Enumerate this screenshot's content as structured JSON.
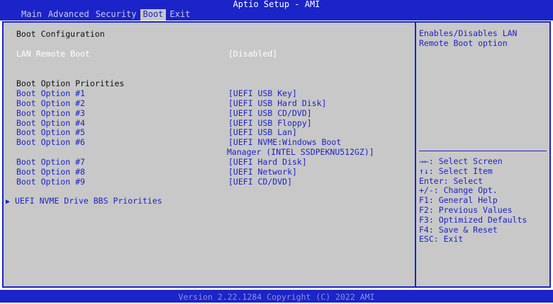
{
  "app": {
    "title": "Aptio Setup - AMI"
  },
  "tabs": [
    {
      "label": "Main"
    },
    {
      "label": "Advanced"
    },
    {
      "label": "Security"
    },
    {
      "label": "Boot",
      "active": true
    },
    {
      "label": "Exit"
    }
  ],
  "main": {
    "section_title": "Boot Configuration",
    "lan_remote_boot": {
      "label": "LAN Remote Boot",
      "value": "[Disabled]"
    },
    "priorities_title": "Boot Option Priorities",
    "boot_options": [
      {
        "label": "Boot Option #1",
        "value": "[UEFI USB Key]"
      },
      {
        "label": "Boot Option #2",
        "value": "[UEFI USB Hard Disk]"
      },
      {
        "label": "Boot Option #3",
        "value": "[UEFI USB CD/DVD]"
      },
      {
        "label": "Boot Option #4",
        "value": "[UEFI USB Floppy]"
      },
      {
        "label": "Boot Option #5",
        "value": "[UEFI USB Lan]"
      },
      {
        "label": "Boot Option #6",
        "value": "[UEFI NVME:Windows Boot",
        "value_cont": "Manager (INTEL SSDPEKNU512GZ)]"
      },
      {
        "label": "Boot Option #7",
        "value": "[UEFI Hard Disk]"
      },
      {
        "label": "Boot Option #8",
        "value": "[UEFI Network]"
      },
      {
        "label": "Boot Option #9",
        "value": "[UEFI CD/DVD]"
      }
    ],
    "submenu": {
      "label": "UEFI NVME Drive BBS Priorities",
      "arrow": "▶"
    }
  },
  "help": {
    "text": "Enables/Disables LAN\nRemote Boot option",
    "keys": [
      "→←: Select Screen",
      "↑↓: Select Item",
      "Enter: Select",
      "+/-: Change Opt.",
      "F1: General Help",
      "F2: Previous Values",
      "F3: Optimized Defaults",
      "F4: Save & Reset",
      "ESC: Exit"
    ]
  },
  "footer": {
    "text": "Version 2.22.1284 Copyright (C) 2022 AMI"
  },
  "colors": {
    "accent": "#1b24c8",
    "panel": "#c8c8c8",
    "selected_text": "#ffffff"
  }
}
